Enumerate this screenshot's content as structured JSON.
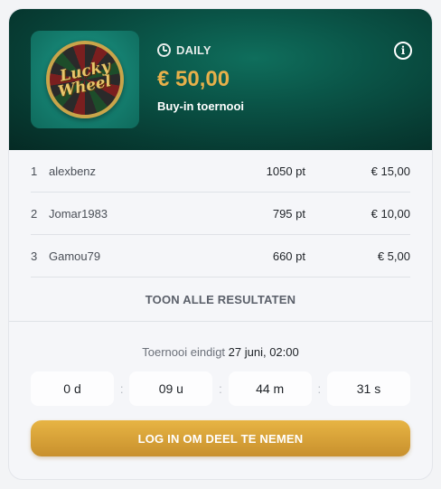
{
  "header": {
    "game_logo_text": [
      "Lucky",
      "Wheel"
    ],
    "frequency_label": "DAILY",
    "prize": "€ 50,00",
    "buyin_label": "Buy-in toernooi",
    "icons": {
      "clock": "clock-icon",
      "info": "info-icon"
    }
  },
  "results": [
    {
      "rank": "1",
      "name": "alexbenz",
      "points": "1050 pt",
      "amount": "€ 15,00"
    },
    {
      "rank": "2",
      "name": "Jomar1983",
      "points": "795 pt",
      "amount": "€ 10,00"
    },
    {
      "rank": "3",
      "name": "Gamou79",
      "points": "660 pt",
      "amount": "€ 5,00"
    }
  ],
  "show_all_label": "TOON ALLE RESULTATEN",
  "tournament_end": {
    "label": "Toernooi eindigt",
    "value": "27 juni, 02:00"
  },
  "countdown": {
    "days": "0 d",
    "hours": "09 u",
    "minutes": "44 m",
    "seconds": "31 s",
    "separator": ":"
  },
  "cta_label": "LOG IN OM DEEL TE NEMEN",
  "colors": {
    "header_bg": "#0a5447",
    "prize": "#e7b04a",
    "cta": "#d9a53a"
  }
}
